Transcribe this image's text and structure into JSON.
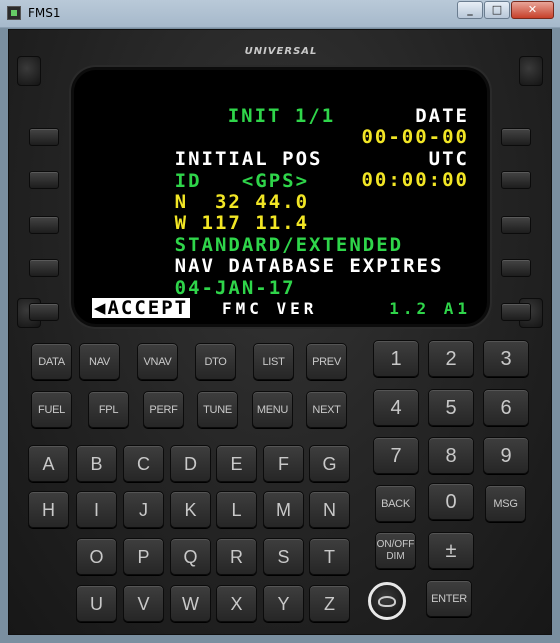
{
  "window": {
    "title": "FMS1",
    "minimize": "_",
    "maximize": "□",
    "close": "✕"
  },
  "brand": "UNIVERSAL",
  "screen": {
    "title": "INIT 1/1",
    "date_label": "DATE",
    "initial_pos_label": "INITIAL POS",
    "date_value": "00-00-00",
    "id_line": "ID   <GPS>",
    "utc_label": "UTC",
    "lat": "N  32 44.0",
    "utc_value": "00:00:00",
    "lon": "W 117 11.4",
    "database_type": "STANDARD/EXTENDED",
    "nav_db_label": "NAV DATABASE EXPIRES",
    "nav_db_date": "04-JAN-17",
    "accept": "◀ACCEPT",
    "fmc_ver_label": "FMC VER",
    "fmc_ver_value": "1.2 A1"
  },
  "keys": {
    "func_row1": [
      "DATA",
      "NAV",
      "VNAV",
      "DTO",
      "LIST",
      "PREV"
    ],
    "func_row2": [
      "FUEL",
      "FPL",
      "PERF",
      "TUNE",
      "MENU",
      "NEXT"
    ],
    "alpha_row1": [
      "A",
      "B",
      "C",
      "D",
      "E",
      "F",
      "G"
    ],
    "alpha_row2": [
      "H",
      "I",
      "J",
      "K",
      "L",
      "M",
      "N"
    ],
    "alpha_row3": [
      "O",
      "P",
      "Q",
      "R",
      "S",
      "T"
    ],
    "alpha_row4": [
      "U",
      "V",
      "W",
      "X",
      "Y",
      "Z"
    ],
    "num_row1": [
      "1",
      "2",
      "3"
    ],
    "num_row2": [
      "4",
      "5",
      "6"
    ],
    "num_row3": [
      "7",
      "8",
      "9"
    ],
    "back": "BACK",
    "zero": "0",
    "msg": "MSG",
    "onoff": "ON/OFF",
    "dim": "DIM",
    "plusminus": "±",
    "enter": "ENTER"
  },
  "colors": {
    "green": "#2fd54a",
    "yellow": "#f2e625",
    "white": "#ffffff"
  }
}
